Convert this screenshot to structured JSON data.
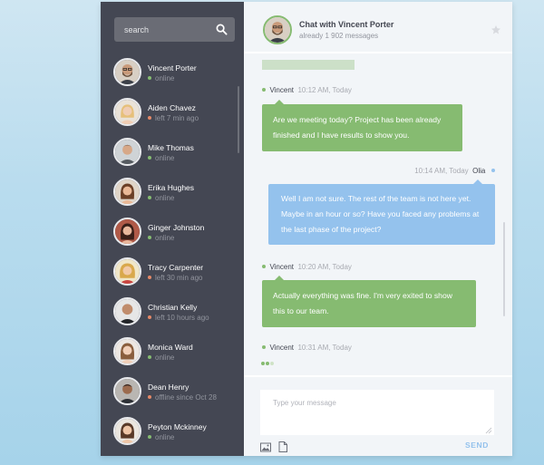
{
  "search": {
    "placeholder": "search"
  },
  "people": [
    {
      "name": "Vincent Porter",
      "status": "online",
      "state": "online",
      "avatar": "man-beard-glasses"
    },
    {
      "name": "Aiden Chavez",
      "status": "left 7 min ago",
      "state": "offline",
      "avatar": "woman-blonde"
    },
    {
      "name": "Mike Thomas",
      "status": "online",
      "state": "online",
      "avatar": "man-dark-hair"
    },
    {
      "name": "Erika Hughes",
      "status": "online",
      "state": "online",
      "avatar": "woman-brunette"
    },
    {
      "name": "Ginger Johnston",
      "status": "online",
      "state": "online",
      "avatar": "woman-dark-hair"
    },
    {
      "name": "Tracy Carpenter",
      "status": "left 30 min ago",
      "state": "offline",
      "avatar": "woman-blonde-curly"
    },
    {
      "name": "Christian Kelly",
      "status": "left 10 hours ago",
      "state": "offline",
      "avatar": "man-bald"
    },
    {
      "name": "Monica Ward",
      "status": "online",
      "state": "online",
      "avatar": "woman-long-hair"
    },
    {
      "name": "Dean Henry",
      "status": "offline since Oct 28",
      "state": "offline",
      "avatar": "man-short-hair"
    },
    {
      "name": "Peyton Mckinney",
      "status": "online",
      "state": "online",
      "avatar": "woman-smiling"
    }
  ],
  "header": {
    "title": "Chat with Vincent Porter",
    "subtitle": "already 1 902 messages"
  },
  "messages": [
    {
      "sender": "Vincent",
      "time": "10:12 AM, Today",
      "side": "left",
      "color": "green",
      "text": "Are we meeting today? Project has been already finished and I have results to show you."
    },
    {
      "sender": "Olia",
      "time": "10:14 AM, Today",
      "side": "right",
      "color": "blue",
      "text": "Well I am not sure. The rest of the team is not here yet. Maybe  in an hour or so?  Have you faced any problems at the last phase of the project?"
    },
    {
      "sender": "Vincent",
      "time": "10:20 AM, Today",
      "side": "left",
      "color": "green",
      "text": "Actually everything was fine. I'm very exited to show this to our team."
    },
    {
      "sender": "Vincent",
      "time": "10:31 AM, Today",
      "side": "left",
      "color": "none",
      "text": ""
    }
  ],
  "composer": {
    "placeholder": "Type your message",
    "send_label": "SEND"
  },
  "colors": {
    "sidebar_bg": "#444753",
    "online": "#86bb71",
    "offline": "#e38968",
    "me_bubble": "#94c2ed",
    "other_bubble": "#86bb71",
    "chat_bg": "#f2f5f8"
  }
}
